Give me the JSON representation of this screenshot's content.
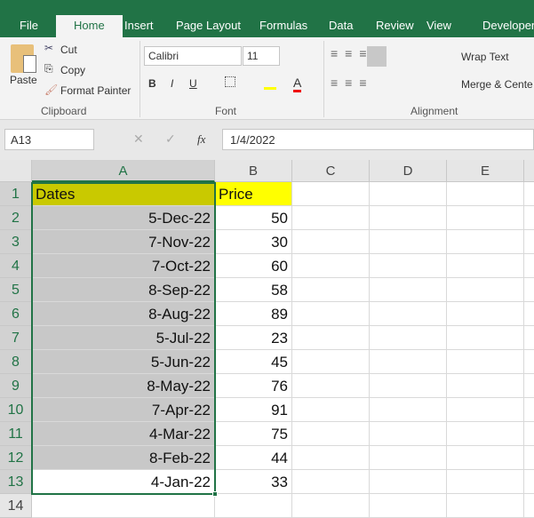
{
  "ribbon_tabs": [
    "File",
    "Home",
    "Insert",
    "Page Layout",
    "Formulas",
    "Data",
    "Review",
    "View",
    "Developer"
  ],
  "active_tab": "Home",
  "clipboard": {
    "paste": "Paste",
    "cut": "Cut",
    "copy": "Copy",
    "format_painter": "Format Painter",
    "group": "Clipboard"
  },
  "font": {
    "name": "Calibri",
    "size": "11",
    "bold": "B",
    "italic": "I",
    "underline": "U",
    "group": "Font",
    "fill_color": "#ffff00",
    "font_color": "#ff0000"
  },
  "alignment": {
    "wrap": "Wrap Text",
    "merge": "Merge & Cente",
    "group": "Alignment"
  },
  "formula_bar": {
    "name_box": "A13",
    "fx": "fx",
    "value": "1/4/2022"
  },
  "columns": [
    "A",
    "B",
    "C",
    "D",
    "E"
  ],
  "rows": [
    {
      "n": "1",
      "a": "Dates",
      "b": "Price"
    },
    {
      "n": "2",
      "a": "5-Dec-22",
      "b": "50"
    },
    {
      "n": "3",
      "a": "7-Nov-22",
      "b": "30"
    },
    {
      "n": "4",
      "a": "7-Oct-22",
      "b": "60"
    },
    {
      "n": "5",
      "a": "8-Sep-22",
      "b": "58"
    },
    {
      "n": "6",
      "a": "8-Aug-22",
      "b": "89"
    },
    {
      "n": "7",
      "a": "5-Jul-22",
      "b": "23"
    },
    {
      "n": "8",
      "a": "5-Jun-22",
      "b": "45"
    },
    {
      "n": "9",
      "a": "8-May-22",
      "b": "76"
    },
    {
      "n": "10",
      "a": "7-Apr-22",
      "b": "91"
    },
    {
      "n": "11",
      "a": "4-Mar-22",
      "b": "75"
    },
    {
      "n": "12",
      "a": "8-Feb-22",
      "b": "44"
    },
    {
      "n": "13",
      "a": "4-Jan-22",
      "b": "33"
    },
    {
      "n": "14",
      "a": "",
      "b": ""
    }
  ]
}
